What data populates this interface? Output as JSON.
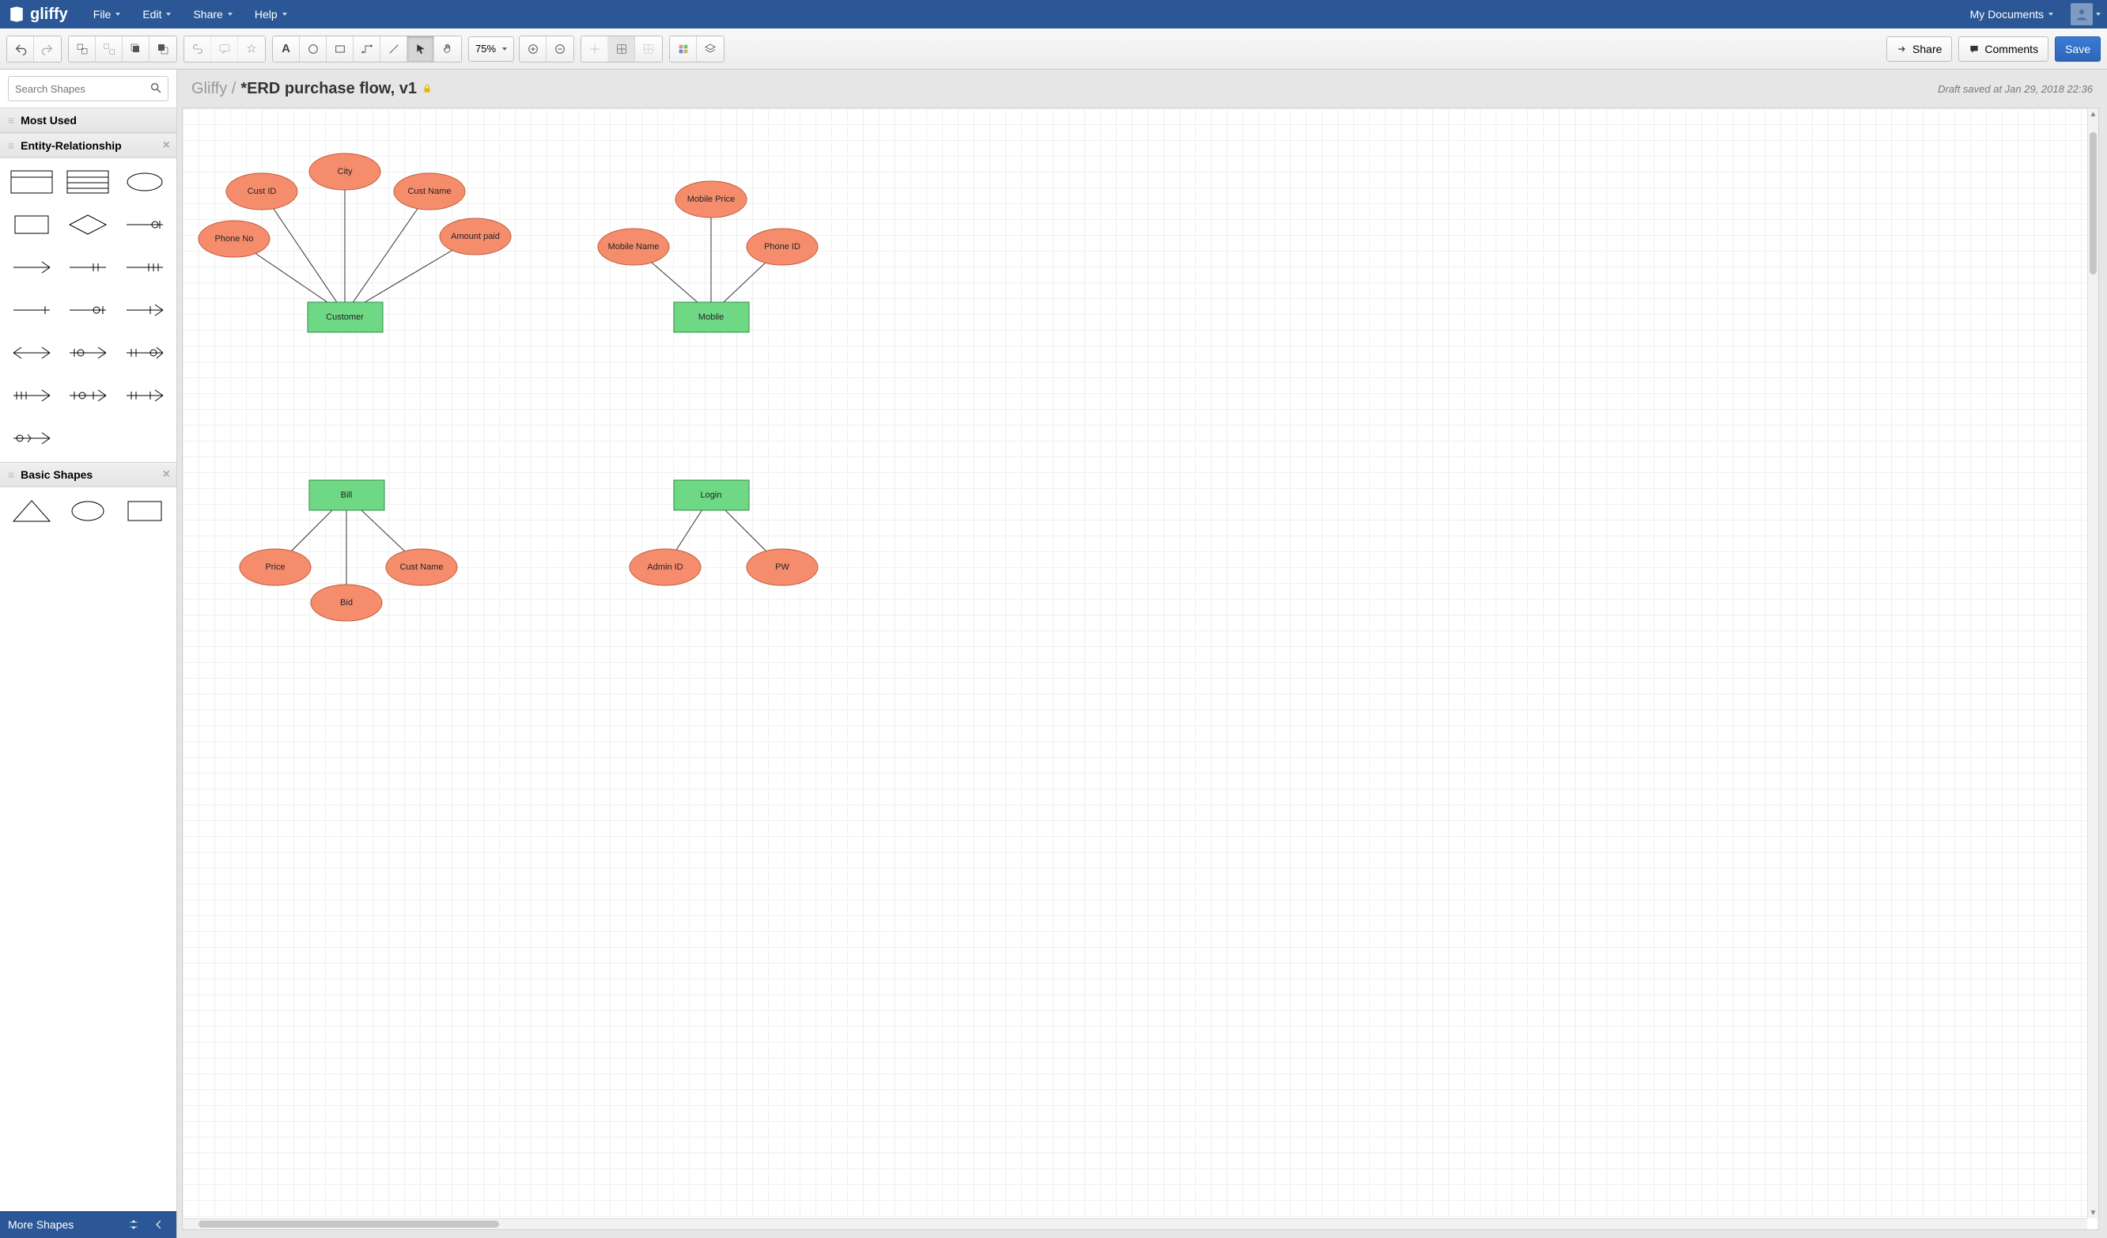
{
  "app": {
    "name": "gliffy"
  },
  "menus": {
    "file": "File",
    "edit": "Edit",
    "share": "Share",
    "help": "Help",
    "mydocs": "My Documents"
  },
  "toolbar": {
    "zoom": "75%",
    "share": "Share",
    "comments": "Comments",
    "save": "Save"
  },
  "search": {
    "placeholder": "Search Shapes"
  },
  "panels": {
    "most_used": "Most Used",
    "er": "Entity-Relationship",
    "basic": "Basic Shapes"
  },
  "sidebar_footer": {
    "more": "More Shapes"
  },
  "doc": {
    "breadcrumb": "Gliffy /",
    "title": "*ERD purchase flow, v1",
    "draft_status": "Draft saved at Jan 29, 2018 22:36"
  },
  "diagram": {
    "entities": {
      "customer": "Customer",
      "mobile": "Mobile",
      "bill": "Bill",
      "login": "Login"
    },
    "attrs": {
      "phone_no": "Phone No",
      "cust_id": "Cust ID",
      "city": "City",
      "cust_name": "Cust Name",
      "amount_paid": "Amount paid",
      "mobile_name": "Mobile Name",
      "mobile_price": "Mobile Price",
      "phone_id": "Phone ID",
      "price": "Price",
      "bid": "Bid",
      "cust_name2": "Cust Name",
      "admin_id": "Admin ID",
      "pw": "PW"
    }
  }
}
